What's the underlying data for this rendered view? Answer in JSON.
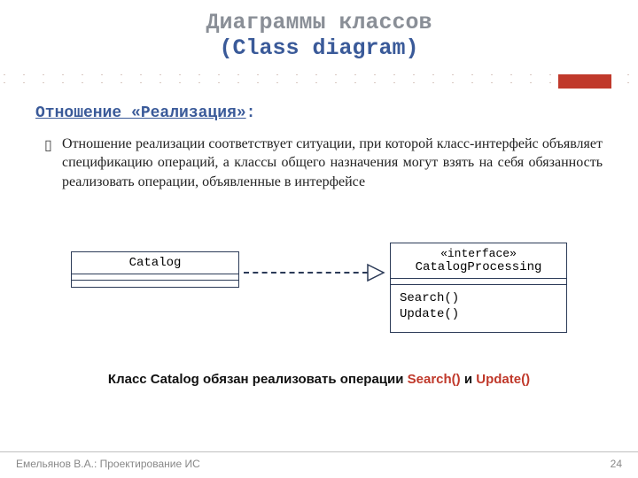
{
  "title": {
    "line1": "Диаграммы классов",
    "line2": "(Class diagram)"
  },
  "subtitle": "Отношение «Реализация»",
  "subtitle_colon": ":",
  "paragraph": "Отношение реализации соответствует ситуации, при которой класс-интерфейс объявляет спецификацию операций, а классы общего назначения могут взять на себя обязанность реализовать операции, объявленные в интерфейсе",
  "diagram": {
    "left_class": {
      "name": "Catalog"
    },
    "right_class": {
      "stereotype": "«interface»",
      "name": "CatalogProcessing",
      "ops": [
        "Search()",
        "Update()"
      ]
    }
  },
  "caption": {
    "prefix": "Класс Catalog обязан реализовать операции ",
    "op1": "Search()",
    "mid": " и ",
    "op2": "Update()"
  },
  "footer": {
    "author": "Емельянов В.А.: Проектирование ИС",
    "page": "24"
  }
}
